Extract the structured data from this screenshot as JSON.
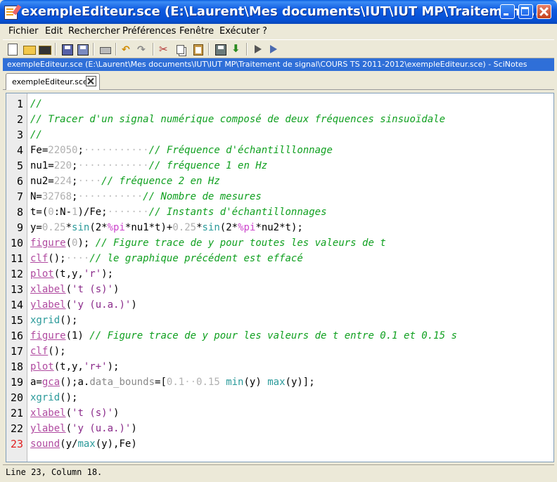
{
  "window": {
    "title": "exempleEditeur.sce (E:\\Laurent\\Mes documents\\IUT\\IUT MP\\Traitement ...",
    "buttons": [
      "minimize",
      "maximize",
      "close"
    ]
  },
  "menu": {
    "items": [
      "Fichier",
      "Edit",
      "Rechercher",
      "Préférences",
      "Fenêtre",
      "Exécuter",
      "?"
    ]
  },
  "toolbar": {
    "icons": [
      "new-file-icon",
      "open-folder-icon",
      "open-file-icon",
      "save-icon",
      "save-as-icon",
      "print-icon",
      "undo-icon",
      "redo-icon",
      "cut-icon",
      "copy-icon",
      "paste-icon",
      "comment-icon",
      "execute-load-icon",
      "run-icon",
      "run-step-icon"
    ]
  },
  "pathbar": {
    "text": "exempleEditeur.sce (E:\\Laurent\\Mes documents\\IUT\\IUT MP\\Traitement de signal\\COURS TS 2011-2012\\exempleEditeur.sce) - SciNotes"
  },
  "tab": {
    "label": "exempleEditeur.sce"
  },
  "editor": {
    "current_line": 23,
    "lines": [
      [
        {
          "t": "//",
          "c": "comment"
        }
      ],
      [
        {
          "t": "// Tracer d'un signal numérique composé de deux fréquences sinsuoïdale",
          "c": "comment"
        }
      ],
      [
        {
          "t": "//",
          "c": "comment"
        }
      ],
      [
        {
          "t": "Fe=",
          "c": ""
        },
        {
          "t": "22050",
          "c": "num"
        },
        {
          "t": ";",
          "c": ""
        },
        {
          "t": "···········",
          "c": "dots"
        },
        {
          "t": "// Fréquence d'échantilllonnage",
          "c": "comment"
        }
      ],
      [
        {
          "t": "nu1=",
          "c": ""
        },
        {
          "t": "220",
          "c": "num"
        },
        {
          "t": ";",
          "c": ""
        },
        {
          "t": "············",
          "c": "dots"
        },
        {
          "t": "// fréquence 1 en Hz",
          "c": "comment"
        }
      ],
      [
        {
          "t": "nu2=",
          "c": ""
        },
        {
          "t": "224",
          "c": "num"
        },
        {
          "t": ";",
          "c": ""
        },
        {
          "t": "····",
          "c": "dots"
        },
        {
          "t": "// fréquence 2 en Hz",
          "c": "comment"
        }
      ],
      [
        {
          "t": "N=",
          "c": ""
        },
        {
          "t": "32768",
          "c": "num"
        },
        {
          "t": ";",
          "c": ""
        },
        {
          "t": "···········",
          "c": "dots"
        },
        {
          "t": "// Nombre de mesures",
          "c": "comment"
        }
      ],
      [
        {
          "t": "t=(",
          "c": ""
        },
        {
          "t": "0",
          "c": "num"
        },
        {
          "t": ":N-",
          "c": ""
        },
        {
          "t": "1",
          "c": "num"
        },
        {
          "t": ")/Fe;",
          "c": ""
        },
        {
          "t": "·······",
          "c": "dots"
        },
        {
          "t": "// Instants d'échantillonnages",
          "c": "comment"
        }
      ],
      [
        {
          "t": "y=",
          "c": ""
        },
        {
          "t": "0.25",
          "c": "num"
        },
        {
          "t": "*",
          "c": ""
        },
        {
          "t": "sin",
          "c": "fn"
        },
        {
          "t": "(2*",
          "c": ""
        },
        {
          "t": "%pi",
          "c": "const"
        },
        {
          "t": "*nu1*t)+",
          "c": ""
        },
        {
          "t": "0.25",
          "c": "num"
        },
        {
          "t": "*",
          "c": ""
        },
        {
          "t": "sin",
          "c": "fn"
        },
        {
          "t": "(2*",
          "c": ""
        },
        {
          "t": "%pi",
          "c": "const"
        },
        {
          "t": "*nu2*t);",
          "c": ""
        }
      ],
      [
        {
          "t": "figure",
          "c": "kw"
        },
        {
          "t": "(",
          "c": ""
        },
        {
          "t": "0",
          "c": "num"
        },
        {
          "t": ");",
          "c": ""
        },
        {
          "t": " // Figure trace de y pour toutes les valeurs de t",
          "c": "comment"
        }
      ],
      [
        {
          "t": "clf",
          "c": "kw"
        },
        {
          "t": "();",
          "c": ""
        },
        {
          "t": "····",
          "c": "dots"
        },
        {
          "t": "// le graphique précédent est effacé",
          "c": "comment"
        }
      ],
      [
        {
          "t": "plot",
          "c": "kw"
        },
        {
          "t": "(t,y,",
          "c": ""
        },
        {
          "t": "'r'",
          "c": "str"
        },
        {
          "t": ");",
          "c": ""
        }
      ],
      [
        {
          "t": "xlabel",
          "c": "kw"
        },
        {
          "t": "(",
          "c": ""
        },
        {
          "t": "'t (s)'",
          "c": "str"
        },
        {
          "t": ")",
          "c": ""
        }
      ],
      [
        {
          "t": "ylabel",
          "c": "kw"
        },
        {
          "t": "(",
          "c": ""
        },
        {
          "t": "'y (u.a.)'",
          "c": "str"
        },
        {
          "t": ")",
          "c": ""
        }
      ],
      [
        {
          "t": "xgrid",
          "c": "fn"
        },
        {
          "t": "();",
          "c": ""
        }
      ],
      [
        {
          "t": "figure",
          "c": "kw"
        },
        {
          "t": "(1)",
          "c": ""
        },
        {
          "t": " // Figure trace de y pour les valeurs de t entre 0.1 et 0.15 s",
          "c": "comment"
        }
      ],
      [
        {
          "t": "clf",
          "c": "kw"
        },
        {
          "t": "();",
          "c": ""
        }
      ],
      [
        {
          "t": "plot",
          "c": "kw"
        },
        {
          "t": "(t,y,",
          "c": ""
        },
        {
          "t": "'r+'",
          "c": "str"
        },
        {
          "t": ");",
          "c": ""
        }
      ],
      [
        {
          "t": "a=",
          "c": ""
        },
        {
          "t": "gca",
          "c": "kw"
        },
        {
          "t": "();a.",
          "c": ""
        },
        {
          "t": "data_bounds",
          "c": "field"
        },
        {
          "t": "=[",
          "c": ""
        },
        {
          "t": "0.1",
          "c": "num"
        },
        {
          "t": "··",
          "c": "dots"
        },
        {
          "t": "0.15",
          "c": "num"
        },
        {
          "t": " ",
          "c": ""
        },
        {
          "t": "min",
          "c": "fn"
        },
        {
          "t": "(y) ",
          "c": ""
        },
        {
          "t": "max",
          "c": "fn"
        },
        {
          "t": "(y)];",
          "c": ""
        }
      ],
      [
        {
          "t": "xgrid",
          "c": "fn"
        },
        {
          "t": "();",
          "c": ""
        }
      ],
      [
        {
          "t": "xlabel",
          "c": "kw"
        },
        {
          "t": "(",
          "c": ""
        },
        {
          "t": "'t (s)'",
          "c": "str"
        },
        {
          "t": ")",
          "c": ""
        }
      ],
      [
        {
          "t": "ylabel",
          "c": "kw"
        },
        {
          "t": "(",
          "c": ""
        },
        {
          "t": "'y (u.a.)'",
          "c": "str"
        },
        {
          "t": ")",
          "c": ""
        }
      ],
      [
        {
          "t": "sound",
          "c": "kw"
        },
        {
          "t": "(y/",
          "c": ""
        },
        {
          "t": "max",
          "c": "fn"
        },
        {
          "t": "(y),Fe)",
          "c": ""
        }
      ]
    ]
  },
  "status": {
    "text": "Line 23, Column 18."
  }
}
